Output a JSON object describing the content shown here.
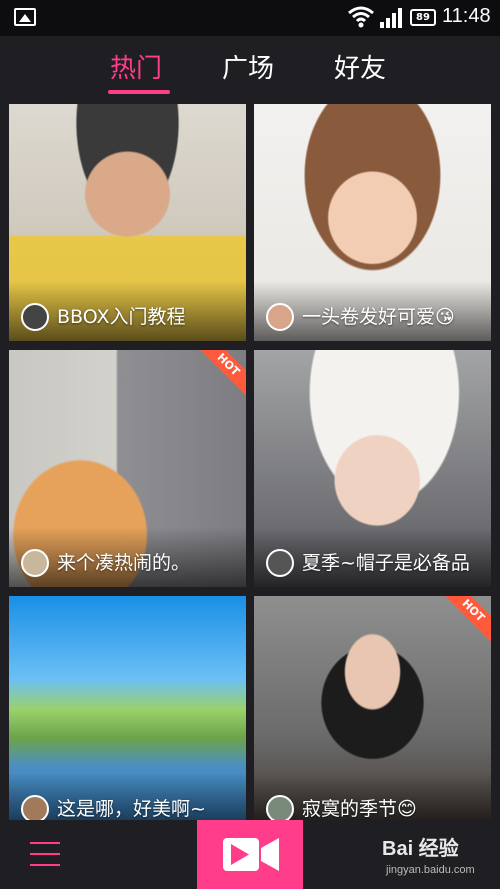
{
  "status_bar": {
    "time": "11:48",
    "battery": "89",
    "icons": [
      "image-icon",
      "wifi-icon",
      "signal-icon",
      "battery-icon"
    ]
  },
  "tabs": [
    {
      "label": "热门",
      "active": true
    },
    {
      "label": "广场",
      "active": false
    },
    {
      "label": "好友",
      "active": false
    }
  ],
  "feed": [
    {
      "caption": "BBOX入门教程",
      "hot": false
    },
    {
      "caption": "一头卷发好可爱😘",
      "hot": false
    },
    {
      "caption": "来个凑热闹的。",
      "hot": true,
      "hot_label": "HOT"
    },
    {
      "caption": "夏季~帽子是必备品",
      "hot": false
    },
    {
      "caption": "这是哪，好美啊~",
      "hot": false
    },
    {
      "caption": "寂寞的季节😊",
      "hot": true,
      "hot_label": "HOT"
    }
  ],
  "bottom_bar": {
    "watermark": "Bai 经验",
    "watermark_url": "jingyan.baidu.com"
  },
  "colors": {
    "accent": "#ff3d8a",
    "background": "#1f1f23",
    "hot": "#ff5a3c"
  }
}
